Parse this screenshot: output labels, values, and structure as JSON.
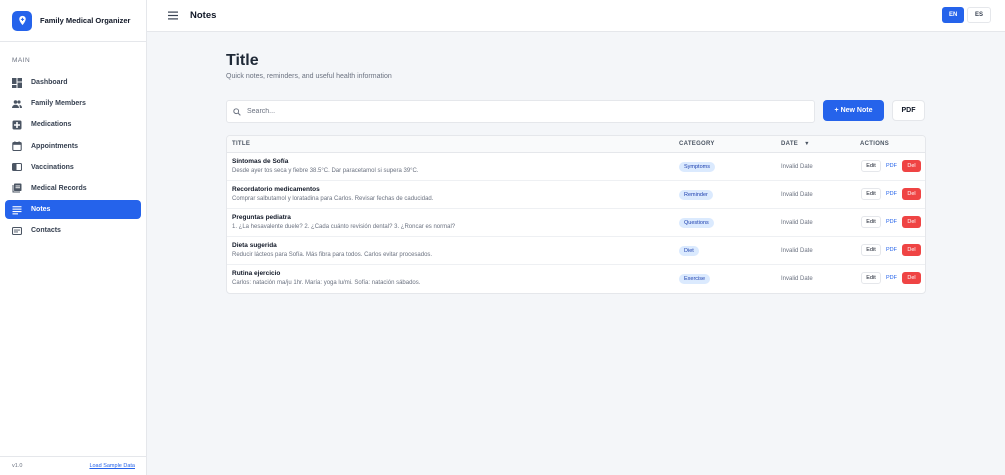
{
  "app": {
    "title": "Family Medical Organizer",
    "version": "v1.0",
    "load_sample": "Load Sample Data"
  },
  "sidebar": {
    "section": "MAIN",
    "items": [
      {
        "label": "Dashboard",
        "icon": "dashboard-icon"
      },
      {
        "label": "Family Members",
        "icon": "people-icon"
      },
      {
        "label": "Medications",
        "icon": "medical-plus-icon"
      },
      {
        "label": "Appointments",
        "icon": "calendar-icon"
      },
      {
        "label": "Vaccinations",
        "icon": "syringe-icon"
      },
      {
        "label": "Medical Records",
        "icon": "records-icon"
      },
      {
        "label": "Notes",
        "icon": "notes-icon",
        "active": true
      },
      {
        "label": "Contacts",
        "icon": "contacts-icon"
      }
    ]
  },
  "topbar": {
    "title": "Notes",
    "lang_en": "EN",
    "lang_es": "ES"
  },
  "page": {
    "title": "Title",
    "subtitle": "Quick notes, reminders, and useful health information",
    "search_placeholder": "Search...",
    "new_note": "+ New Note",
    "pdf": "PDF"
  },
  "table": {
    "headers": {
      "title": "TITLE",
      "category": "CATEGORY",
      "date": "DATE",
      "sort_arrow": "▼",
      "actions": "ACTIONS"
    },
    "actions": {
      "edit": "Edit",
      "pdf": "PDF",
      "del": "Del"
    },
    "rows": [
      {
        "title": "Síntomas de Sofía",
        "desc": "Desde ayer tos seca y fiebre 38.5°C. Dar paracetamol si supera 39°C.",
        "category": "Symptoms",
        "date": "Invalid Date"
      },
      {
        "title": "Recordatorio medicamentos",
        "desc": "Comprar salbutamol y loratadina para Carlos. Revisar fechas de caducidad.",
        "category": "Reminder",
        "date": "Invalid Date"
      },
      {
        "title": "Preguntas pediatra",
        "desc": "1. ¿La hesavalente duele? 2. ¿Cada cuánto revisión dental? 3. ¿Roncar es normal?",
        "category": "Questions",
        "date": "Invalid Date"
      },
      {
        "title": "Dieta sugerida",
        "desc": "Reducir lácteos para Sofía. Más fibra para todos. Carlos evitar procesados.",
        "category": "Diet",
        "date": "Invalid Date"
      },
      {
        "title": "Rutina ejercicio",
        "desc": "Carlos: natación ma/ju 1hr. María: yoga lu/mi. Sofía: natación sábados.",
        "category": "Exercise",
        "date": "Invalid Date"
      }
    ]
  },
  "colors": {
    "accent": "#2563eb",
    "danger": "#ef4444",
    "badge_bg": "#dbeafe",
    "badge_text": "#1e40af"
  }
}
